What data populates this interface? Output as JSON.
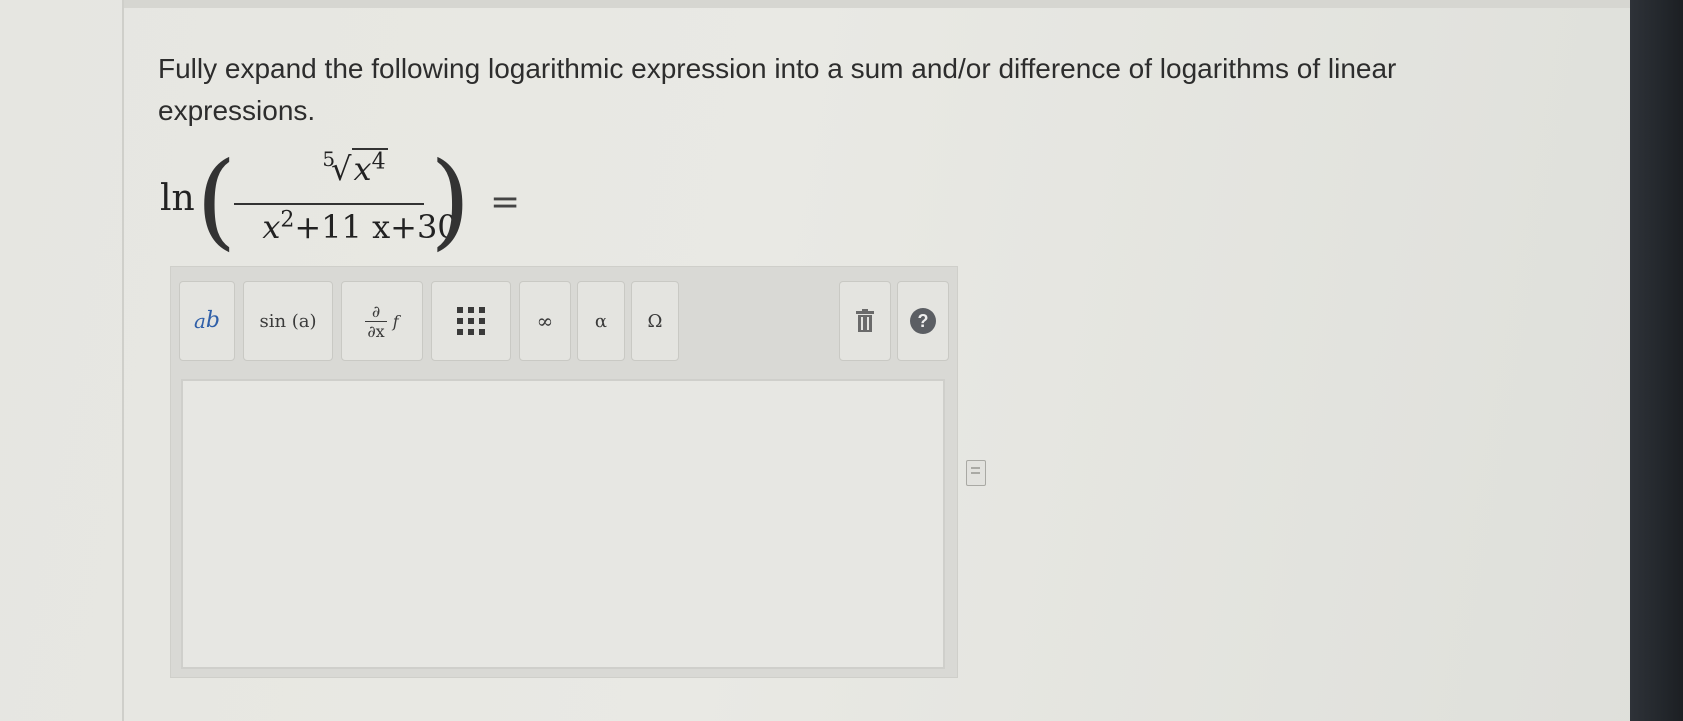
{
  "question": {
    "text": "Fully expand the following logarithmic expression into a sum and/or difference of logarithms of linear expressions."
  },
  "expression": {
    "ln": "ln",
    "open_paren": "(",
    "close_paren": ")",
    "root_index": "5",
    "numerator_base": "x",
    "numerator_exp": "4",
    "den_base": "x",
    "den_exp": "2",
    "den_rest": "+11 x+30",
    "equals": "="
  },
  "toolbar": {
    "power_base": "a",
    "power_exp": "b",
    "trig": "sin (a)",
    "partial_top": "∂",
    "partial_bottom": "∂x",
    "partial_f": "f",
    "matrix": "⋮⋮⋮",
    "infinity": "∞",
    "alpha": "α",
    "omega": "Ω",
    "help": "?"
  },
  "icons": {
    "trash": "trash-icon",
    "help": "help-icon",
    "matrix": "matrix-icon",
    "side": "scratchpad-icon"
  }
}
